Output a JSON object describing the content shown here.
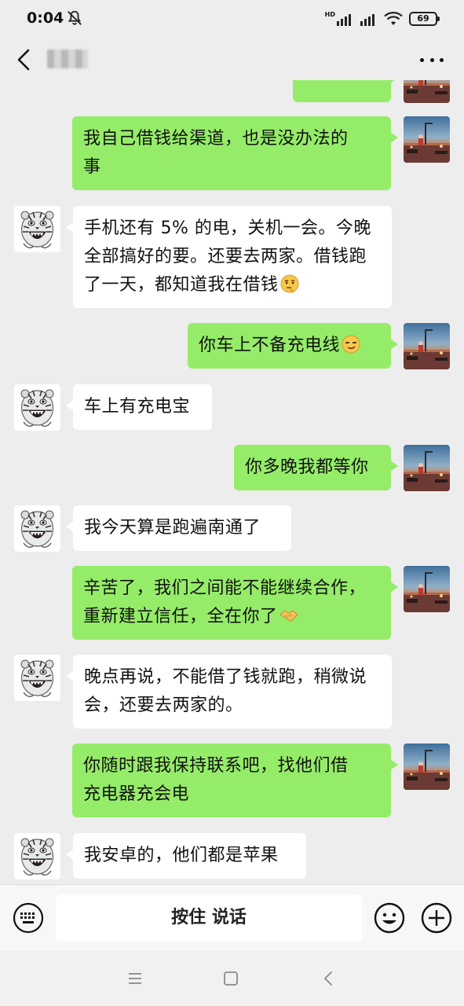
{
  "status_bar": {
    "time": "0:04",
    "hd_label": "HD",
    "battery": "69"
  },
  "header": {
    "contact_name": "",
    "back_icon": "chevron-left-icon",
    "more_icon": "more-dots-icon"
  },
  "messages": [
    {
      "from": "me",
      "text": ""
    },
    {
      "from": "me",
      "text": "我自己借钱给渠道，也是没办法的事",
      "lines": [
        "我自己借钱给渠道，也是没办法的",
        "事"
      ]
    },
    {
      "from": "other",
      "lines": [
        "手机还有 5% 的电，关机一会。今晚",
        "全部搞好的要。还要去两家。借钱跑",
        "了一天，都知道我在借钱"
      ],
      "emoji": "thinking-face"
    },
    {
      "from": "me",
      "text": "你车上不备充电线",
      "emoji": "smirk-face"
    },
    {
      "from": "other",
      "text": "车上有充电宝"
    },
    {
      "from": "me",
      "text": "你多晚我都等你"
    },
    {
      "from": "other",
      "text": "我今天算是跑遍南通了"
    },
    {
      "from": "me",
      "lines": [
        "辛苦了，我们之间能不能继续合作，",
        "重新建立信任，全在你了"
      ],
      "emoji": "handshake"
    },
    {
      "from": "other",
      "lines": [
        "晚点再说，不能借了钱就跑，稍微说",
        "会，还要去两家的。"
      ]
    },
    {
      "from": "me",
      "lines": [
        "你随时跟我保持联系吧，找他们借",
        "充电器充会电"
      ]
    },
    {
      "from": "other",
      "text": "我安卓的，他们都是苹果"
    }
  ],
  "input_bar": {
    "hold_to_talk": "按住 说话",
    "voice_icon": "keyboard-icon",
    "emoji_icon": "smiley-icon",
    "plus_icon": "plus-circle-icon"
  },
  "nav_bar": {
    "icons": [
      "menu-icon",
      "home-square-icon",
      "back-triangle-icon"
    ]
  },
  "colors": {
    "me_bubble": "#95ec69",
    "other_bubble": "#ffffff",
    "background": "#ededed"
  }
}
